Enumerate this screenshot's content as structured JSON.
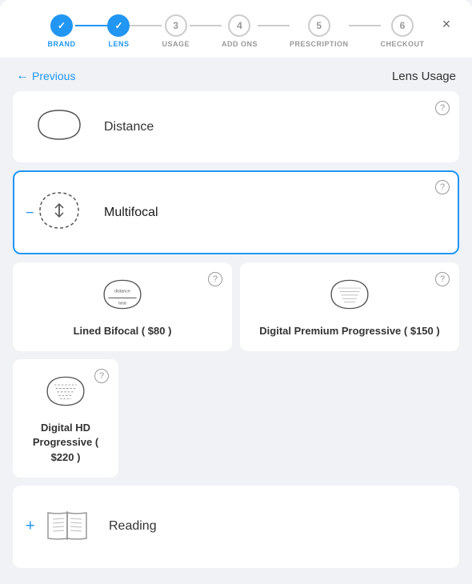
{
  "modal": {
    "close_label": "×"
  },
  "steps": [
    {
      "id": "brand",
      "label": "BRAND",
      "state": "completed",
      "number": "✓"
    },
    {
      "id": "lens",
      "label": "LENS",
      "state": "completed",
      "number": "✓"
    },
    {
      "id": "usage",
      "label": "USAGE",
      "state": "active",
      "number": "3"
    },
    {
      "id": "addons",
      "label": "ADD ONS",
      "state": "inactive",
      "number": "4"
    },
    {
      "id": "prescription",
      "label": "PRESCRIPTION",
      "state": "inactive",
      "number": "5"
    },
    {
      "id": "checkout",
      "label": "CHECKOUT",
      "state": "inactive",
      "number": "6"
    }
  ],
  "connectors": [
    {
      "state": "completed"
    },
    {
      "state": "active"
    },
    {
      "state": "inactive"
    },
    {
      "state": "inactive"
    },
    {
      "state": "inactive"
    }
  ],
  "navigation": {
    "previous_label": "Previous",
    "section_title": "Lens Usage"
  },
  "options": [
    {
      "id": "distance",
      "label": "Distance",
      "state": "normal",
      "has_help": true,
      "has_minus": false
    },
    {
      "id": "multifocal",
      "label": "Multifocal",
      "state": "selected",
      "has_help": true,
      "has_minus": true
    }
  ],
  "sub_options": [
    {
      "id": "lined-bifocal",
      "label": "Lined Bifocal ( $80 )",
      "has_help": true
    },
    {
      "id": "digital-premium",
      "label": "Digital Premium Progressive ( $150 )",
      "has_help": true
    },
    {
      "id": "digital-hd",
      "label": "Digital HD Progressive ( $220 )",
      "has_help": true
    }
  ],
  "reading_option": {
    "id": "reading",
    "label": "Reading",
    "has_help": false,
    "has_plus": true
  }
}
